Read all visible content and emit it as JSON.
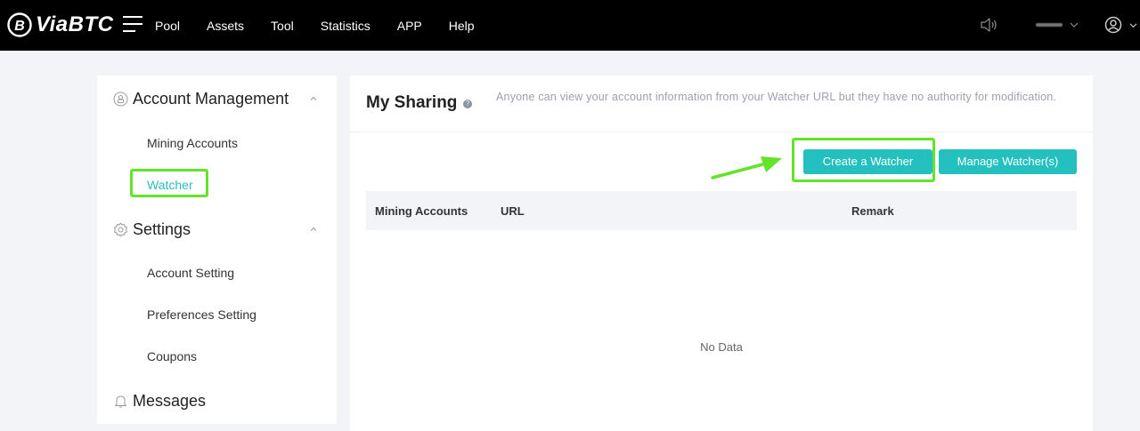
{
  "topbar": {
    "logo_text": "ViaBTC",
    "nav": [
      "Pool",
      "Assets",
      "Tool",
      "Statistics",
      "APP",
      "Help"
    ]
  },
  "sidebar": {
    "account_management": {
      "title": "Account Management",
      "items": [
        "Mining Accounts",
        "Watcher"
      ]
    },
    "settings": {
      "title": "Settings",
      "items": [
        "Account Setting",
        "Preferences Setting",
        "Coupons"
      ]
    },
    "messages": {
      "title": "Messages"
    },
    "active_item": "Watcher"
  },
  "main": {
    "title": "My Sharing",
    "description": "Anyone can view your account information from your Watcher URL but they have no authority for modification.",
    "buttons": {
      "create": "Create a Watcher",
      "manage": "Manage Watcher(s)"
    },
    "table": {
      "columns": [
        "Mining Accounts",
        "URL",
        "Remark"
      ],
      "empty_text": "No Data"
    }
  },
  "colors": {
    "accent": "#24c0c0",
    "highlight": "#65e32a",
    "topbar_bg": "#000000",
    "page_bg": "#f3f4f7"
  }
}
